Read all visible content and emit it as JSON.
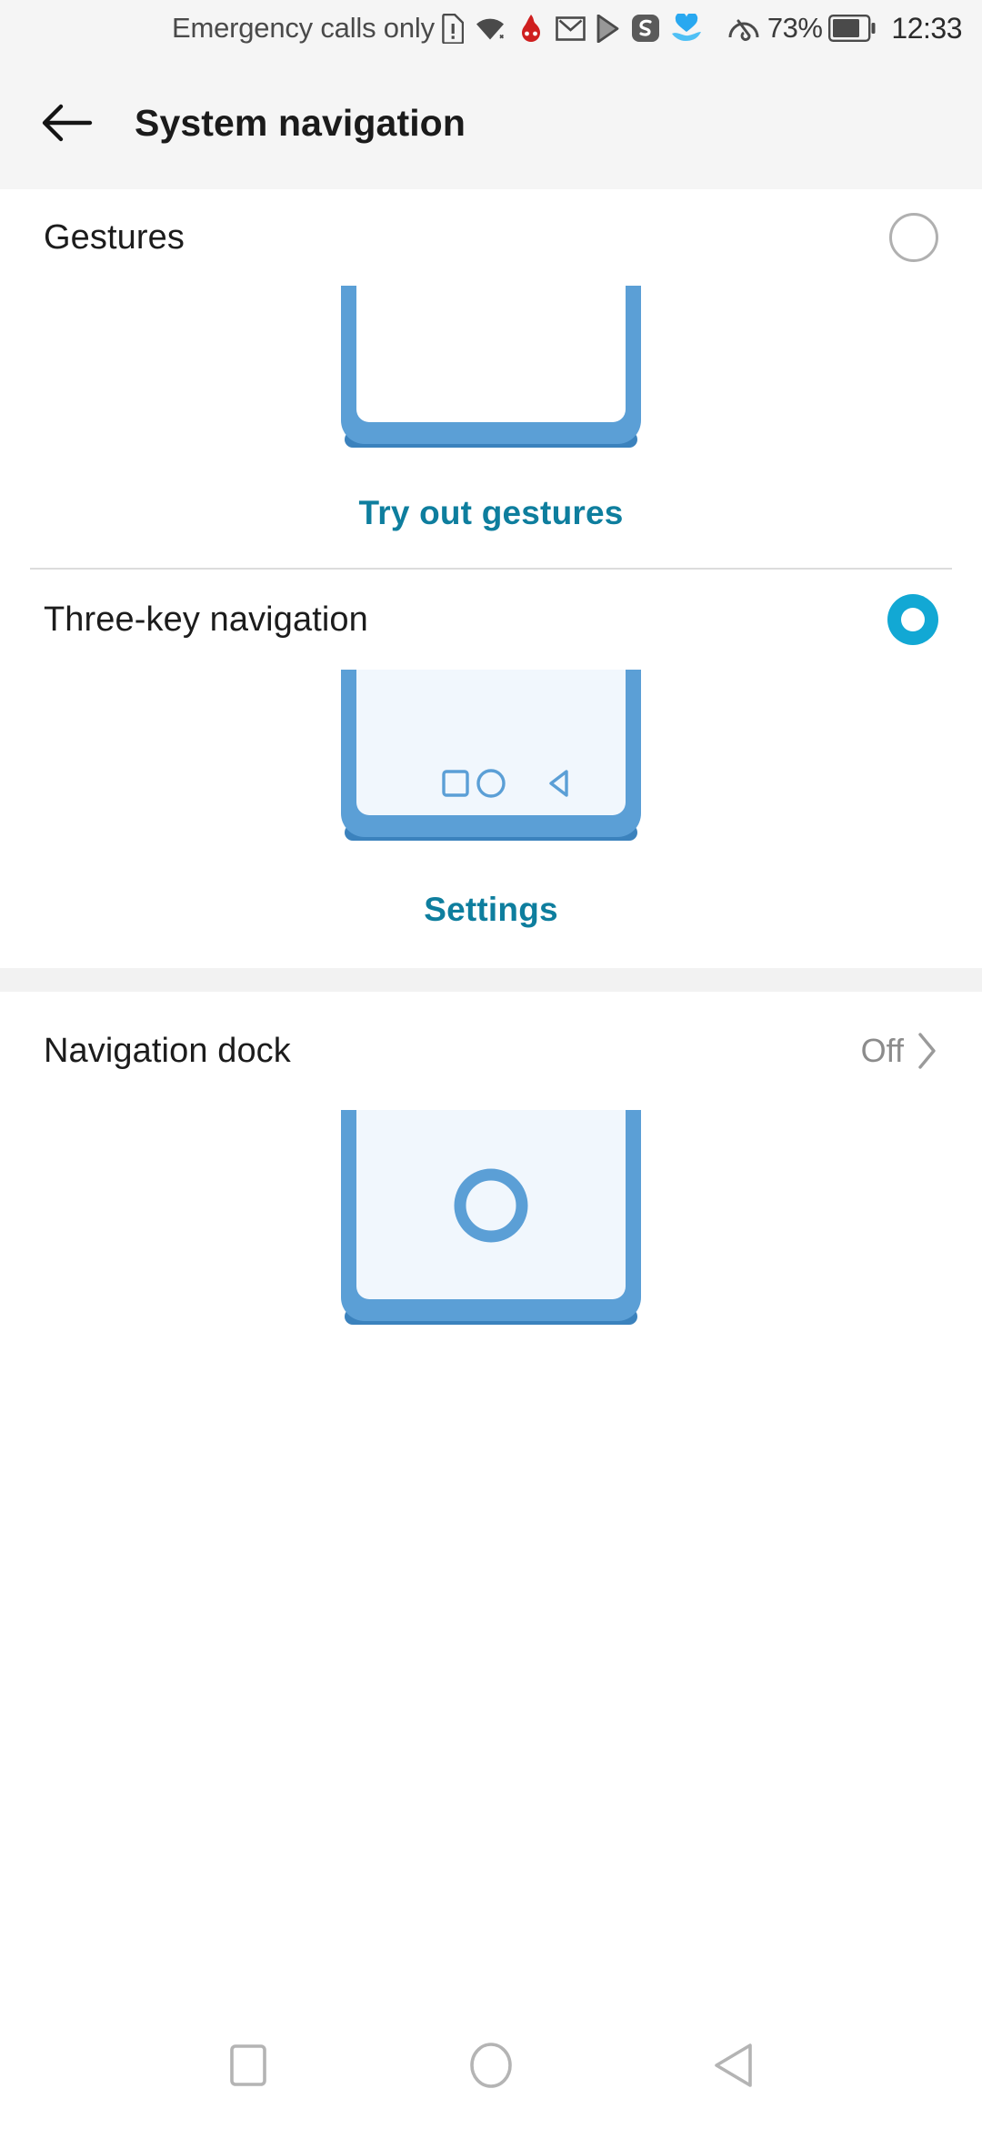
{
  "status_bar": {
    "carrier_text": "Emergency calls only",
    "icons": [
      {
        "name": "sim-card-alert-icon"
      },
      {
        "name": "wifi-icon"
      },
      {
        "name": "antutu-app-icon"
      },
      {
        "name": "gmail-icon"
      },
      {
        "name": "play-store-icon"
      },
      {
        "name": "scribd-app-icon"
      },
      {
        "name": "health-heart-icon"
      }
    ],
    "data_saver_icon": "speedometer-icon",
    "battery_percent": "73%",
    "battery_icon": "battery-icon",
    "time": "12:33"
  },
  "app_bar": {
    "back_icon": "arrow-left-icon",
    "title": "System navigation"
  },
  "sections": {
    "gestures": {
      "label": "Gestures",
      "radio_state": "unselected",
      "illustration": "phone-gestures-illustration",
      "link_label": "Try out gestures"
    },
    "three_key": {
      "label": "Three-key navigation",
      "radio_state": "selected",
      "illustration": "phone-three-key-illustration",
      "nav_keys": [
        {
          "name": "recents-square-icon"
        },
        {
          "name": "home-circle-icon"
        },
        {
          "name": "back-triangle-icon"
        }
      ],
      "link_label": "Settings"
    },
    "navigation_dock": {
      "label": "Navigation dock",
      "value": "Off",
      "chevron_icon": "chevron-right-icon",
      "illustration": "phone-nav-dock-illustration"
    }
  },
  "system_nav_bar": {
    "buttons": [
      {
        "name": "recents-button"
      },
      {
        "name": "home-button"
      },
      {
        "name": "back-button"
      }
    ]
  },
  "colors": {
    "accent_teal": "#0e7e9e",
    "radio_selected": "#12a8d4",
    "illustration_blue": "#5b9fd6",
    "illustration_blue_dark": "#3b82bd",
    "illustration_screen": "#f1f7fd",
    "header_bg": "#f5f5f5",
    "divider": "#dcdcdc"
  }
}
